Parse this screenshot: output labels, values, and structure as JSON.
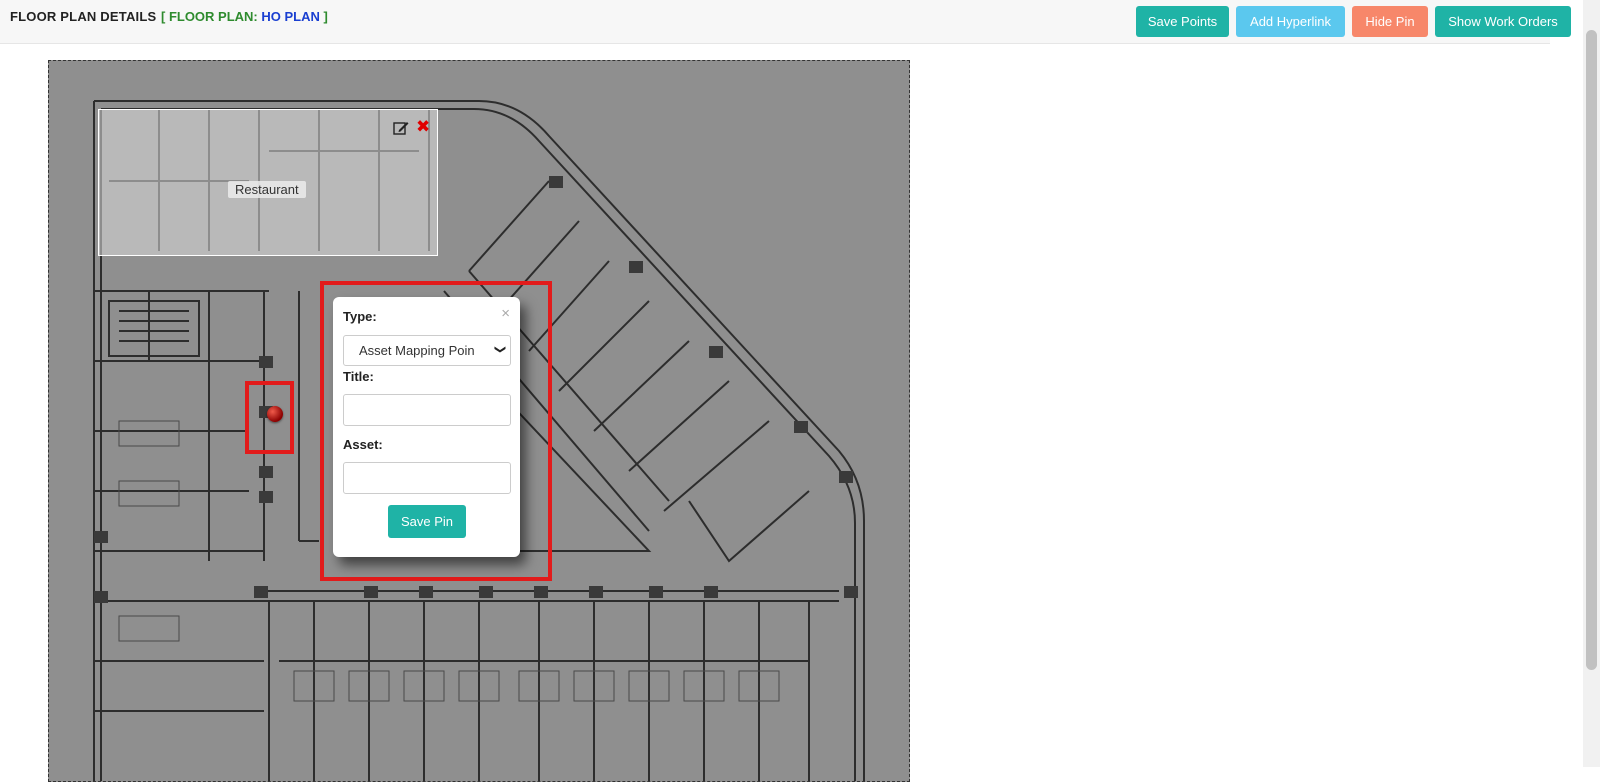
{
  "header": {
    "title": "FLOOR PLAN DETAILS",
    "subtitle_prefix": "[ FLOOR PLAN: ",
    "subtitle_value": "HO PLAN",
    "subtitle_suffix": " ]"
  },
  "toolbar": {
    "save_points": "Save Points",
    "add_hyperlink": "Add Hyperlink",
    "hide_pin": "Hide Pin",
    "show_work_orders": "Show Work Orders"
  },
  "floorplan": {
    "room_label": "Restaurant"
  },
  "popup": {
    "type_label": "Type:",
    "type_value": "Asset Mapping Poin",
    "title_label": "Title:",
    "title_value": "",
    "asset_label": "Asset:",
    "asset_value": "",
    "save_button": "Save Pin",
    "close_glyph": "×"
  },
  "colors": {
    "accent": "#1fb3a6",
    "hyperlink": "#5bc8ee",
    "hide_pin": "#f7876a",
    "highlight": "#e21b1b",
    "subtitle_green": "#2e8b2e",
    "subtitle_blue": "#1a3fd1"
  }
}
